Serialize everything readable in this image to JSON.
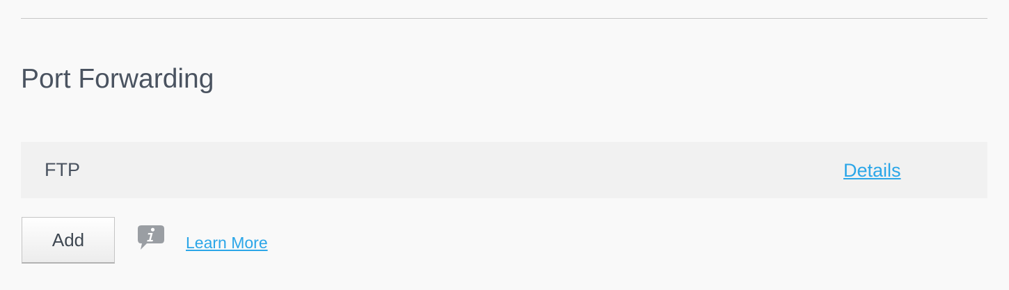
{
  "section": {
    "title": "Port Forwarding"
  },
  "port_forwarding": {
    "entries": [
      {
        "name": "FTP",
        "details_label": "Details"
      }
    ]
  },
  "actions": {
    "add_label": "Add",
    "info_icon": "info-speech-bubble-icon",
    "learn_more_label": "Learn More"
  },
  "colors": {
    "link": "#2ba6e8",
    "text": "#4a5360",
    "icon": "#9a9ea3",
    "row_background": "#f1f1f1",
    "page_background": "#f9f9f9"
  }
}
